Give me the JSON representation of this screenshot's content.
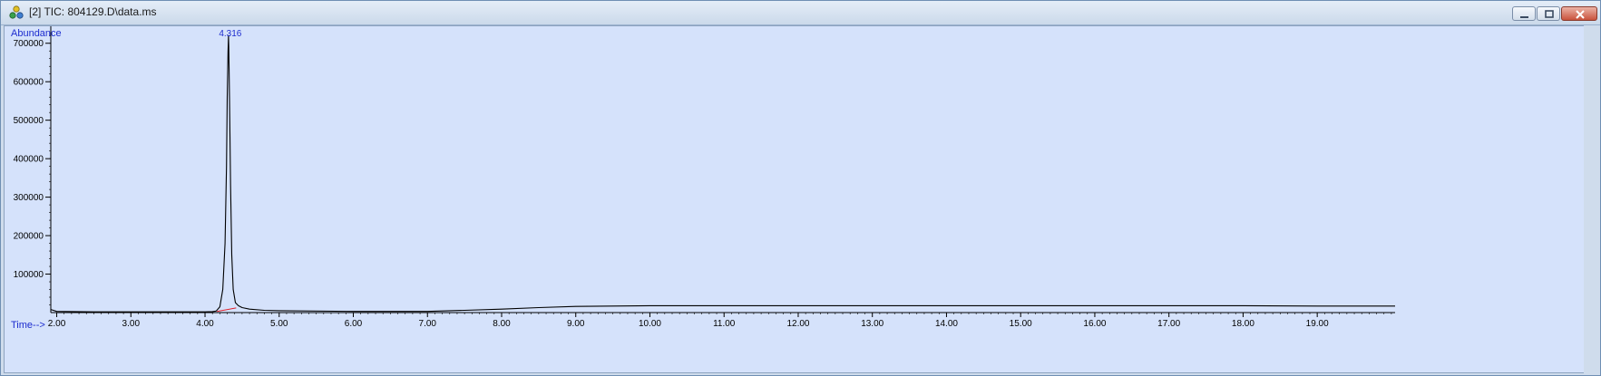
{
  "window": {
    "title": "[2] TIC: 804129.D\\data.ms",
    "app_icon": "chemstation-molecule-icon",
    "buttons": [
      "minimize-icon",
      "restore-icon",
      "close-icon"
    ]
  },
  "colors": {
    "plot_background": "#d5e2fb",
    "trace": "#000000",
    "axis_label": "#1d2ccf",
    "peak_label": "#1d2ccf",
    "baseline_marker": "#e0202a"
  },
  "chart_data": {
    "type": "line",
    "ylabel": "Abundance",
    "xlabel": "Time-->",
    "xlim": [
      1.92,
      20.05
    ],
    "ylim": [
      0,
      730000
    ],
    "x_ticks": [
      "2.00",
      "3.00",
      "4.00",
      "5.00",
      "6.00",
      "7.00",
      "8.00",
      "9.00",
      "10.00",
      "11.00",
      "12.00",
      "13.00",
      "14.00",
      "15.00",
      "16.00",
      "17.00",
      "18.00",
      "19.00"
    ],
    "y_ticks": [
      "100000",
      "200000",
      "300000",
      "400000",
      "500000",
      "600000",
      "700000"
    ],
    "grid": false,
    "peak_labels": [
      {
        "x": 4.316,
        "text": "4.316"
      }
    ],
    "baseline_segment": [
      [
        4.16,
        3000
      ],
      [
        4.42,
        12000
      ]
    ],
    "series": [
      {
        "x": [
          1.92,
          2.0,
          2.5,
          3.0,
          3.5,
          4.0,
          4.1,
          4.15,
          4.2,
          4.24,
          4.27,
          4.29,
          4.3,
          4.31,
          4.316,
          4.32,
          4.33,
          4.345,
          4.36,
          4.38,
          4.41,
          4.45,
          4.5,
          4.6,
          4.8,
          5.0,
          6.0,
          7.0,
          7.5,
          8.0,
          8.5,
          9.0,
          10.0,
          11.0,
          12.0,
          13.0,
          14.0,
          15.0,
          16.0,
          17.0,
          18.0,
          19.0,
          20.05
        ],
        "y": [
          8000,
          3000,
          2000,
          2000,
          2000,
          2000,
          2500,
          4000,
          15000,
          60000,
          180000,
          380000,
          560000,
          680000,
          720000,
          690000,
          560000,
          330000,
          150000,
          60000,
          26000,
          18000,
          13000,
          9000,
          6000,
          5000,
          3000,
          3000,
          6000,
          9000,
          13000,
          16000,
          18000,
          18000,
          18000,
          18000,
          18000,
          18000,
          18000,
          18000,
          18000,
          17000,
          17000
        ]
      }
    ]
  }
}
